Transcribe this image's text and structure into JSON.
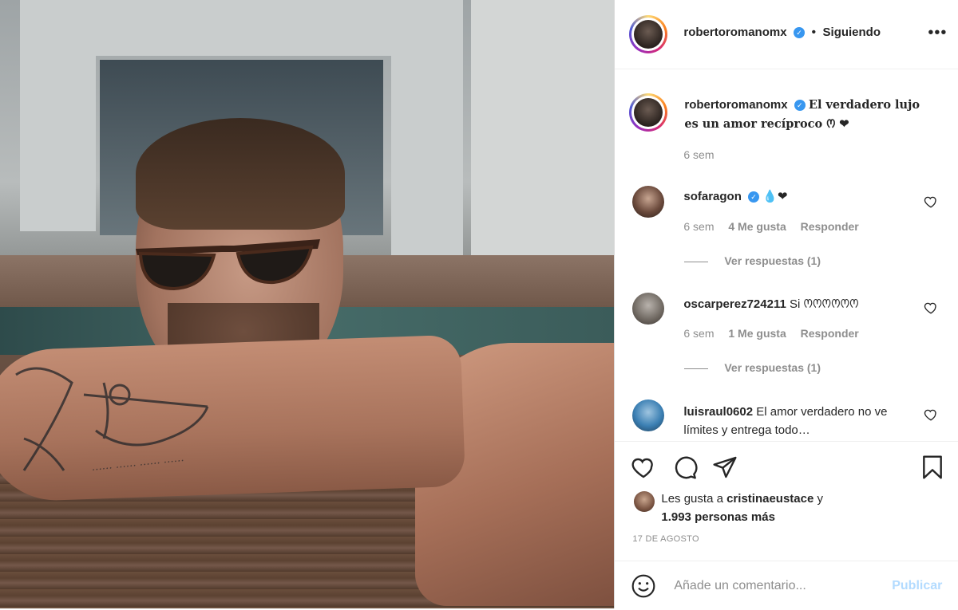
{
  "post": {
    "author": "robertoromanomx",
    "follow_status": "Siguiendo",
    "dot": "•",
    "more_label": "•••",
    "caption": "El verdadero lujo es un amor recíproco 𞋒 ❤",
    "caption_time": "6 sem"
  },
  "comments": [
    {
      "username": "sofaragon",
      "text": "💧❤",
      "time": "6 sem",
      "likes": "4 Me gusta",
      "reply": "Responder",
      "view_replies": "Ver respuestas (1)"
    },
    {
      "username": "oscarperez724211",
      "text": "Si 𞋒𞋒𞋒𞋒𞋒𞋒",
      "time": "6 sem",
      "likes": "1 Me gusta",
      "reply": "Responder",
      "view_replies": "Ver respuestas (1)"
    },
    {
      "username": "luisraul0602",
      "text": "El amor verdadero no ve límites y entrega todo…"
    }
  ],
  "likes_summary": {
    "prefix": "Les gusta a",
    "liker": "cristinaeustace",
    "conj": "y",
    "count_text": "1.993 personas más"
  },
  "date": "17 DE AGOSTO",
  "add_comment": {
    "placeholder": "Añade un comentario...",
    "publish": "Publicar"
  },
  "colors": {
    "verified": "#3897f0",
    "heart": "#ed4956",
    "muted": "#8e8e8e",
    "publish_disabled": "#b3dbff"
  },
  "icons": [
    "verified-badge-icon",
    "more-options-icon",
    "heart-icon",
    "comment-icon",
    "share-icon",
    "save-icon",
    "emoji-icon"
  ]
}
